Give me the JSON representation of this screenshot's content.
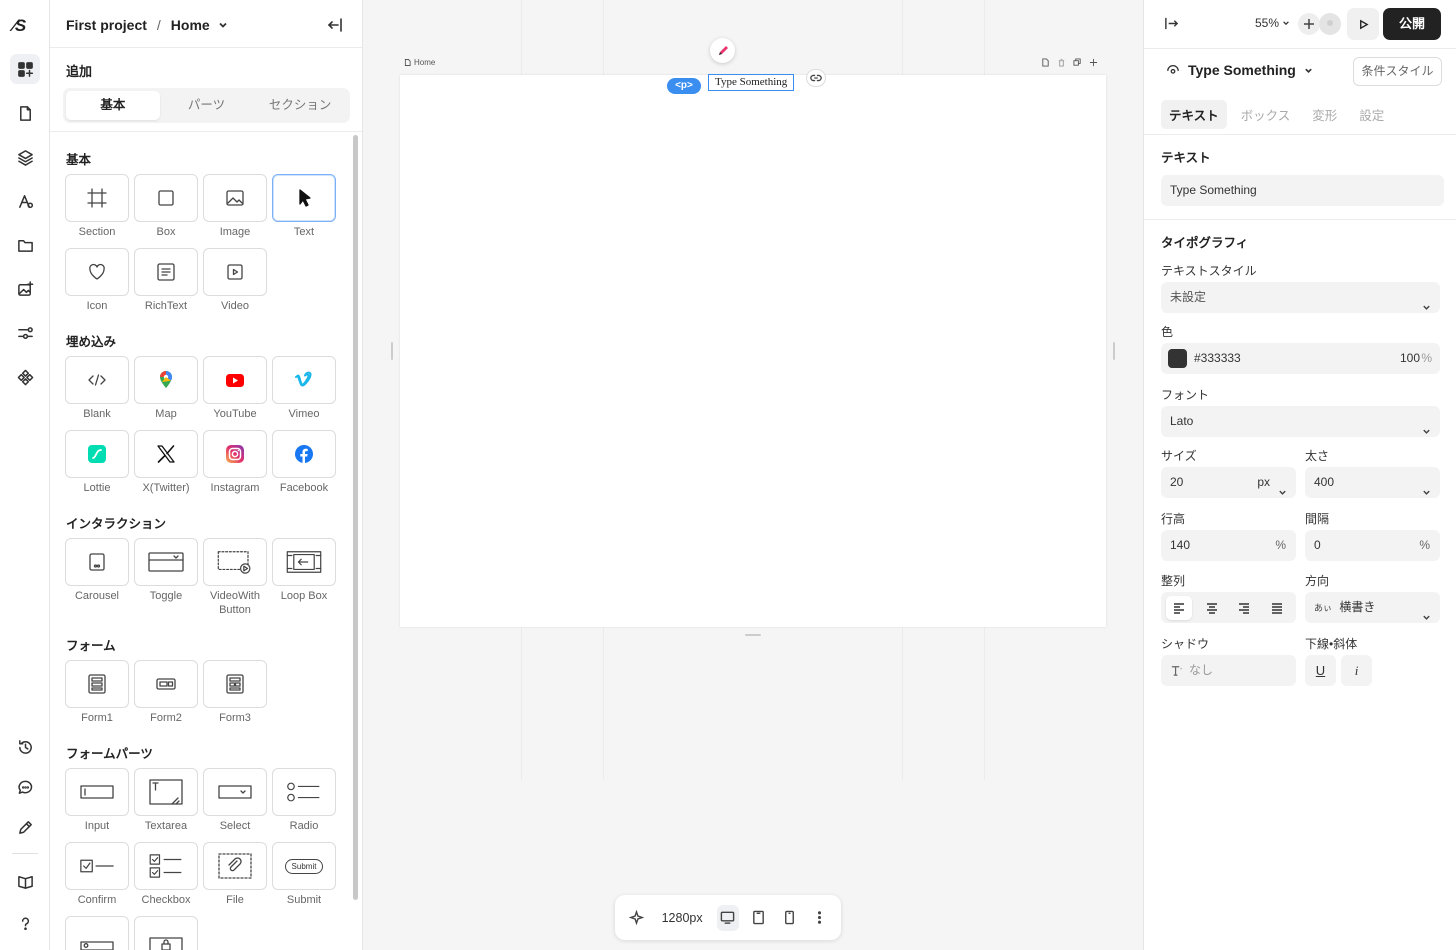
{
  "rail": {
    "logo": "⁄S",
    "icons": [
      "add-elements-icon",
      "pages-icon",
      "layers-icon",
      "styles-icon",
      "folder-icon",
      "media-icon",
      "components-icon",
      "widgets-icon",
      "history-icon",
      "comments-icon",
      "edit-icon",
      "docs-icon",
      "help-icon"
    ]
  },
  "left_panel": {
    "project": "First project",
    "separator": "/",
    "page": "Home",
    "add_title": "追加",
    "tabs": [
      "基本",
      "パーツ",
      "セクション"
    ],
    "active_tab": 0,
    "sections": {
      "basic": {
        "title": "基本",
        "items": [
          "Section",
          "Box",
          "Image",
          "Text",
          "Icon",
          "RichText",
          "Video"
        ]
      },
      "embed": {
        "title": "埋め込み",
        "items": [
          "Blank",
          "Map",
          "YouTube",
          "Vimeo",
          "Lottie",
          "X(Twitter)",
          "Instagram",
          "Facebook"
        ]
      },
      "interaction": {
        "title": "インタラクション",
        "items": [
          "Carousel",
          "Toggle",
          "VideoWith Button",
          "Loop Box"
        ]
      },
      "form": {
        "title": "フォーム",
        "items": [
          "Form1",
          "Form2",
          "Form3"
        ]
      },
      "form_parts": {
        "title": "フォームパーツ",
        "items": [
          "Input",
          "Textarea",
          "Select",
          "Radio",
          "Confirm",
          "Checkbox",
          "File",
          "Submit"
        ]
      }
    },
    "submit_tile_text": "Submit",
    "selected_item": "Text"
  },
  "canvas": {
    "artboard_label": "Home",
    "tag": "<p>",
    "selected_text": "Type Something",
    "width_label": "1280px"
  },
  "right_panel": {
    "zoom": "55%",
    "publish_label": "公開",
    "element_name": "Type Something",
    "conditional_style": "条件スタイル",
    "tabs": [
      "テキスト",
      "ボックス",
      "変形",
      "設定"
    ],
    "active_tab": 0,
    "text_section_title": "テキスト",
    "text_value": "Type Something",
    "typography_title": "タイポグラフィ",
    "text_style_label": "テキストスタイル",
    "text_style_value": "未設定",
    "color_label": "色",
    "color_hex": "#333333",
    "color_opacity": "100",
    "percent": "%",
    "font_label": "フォント",
    "font_value": "Lato",
    "size_label": "サイズ",
    "size_value": "20",
    "size_unit": "px",
    "weight_label": "太さ",
    "weight_value": "400",
    "line_height_label": "行高",
    "line_height_value": "140",
    "spacing_label": "間隔",
    "spacing_value": "0",
    "align_label": "整列",
    "direction_label": "方向",
    "direction_value": "横書き",
    "direction_icon_text": "あぃ",
    "shadow_label": "シャドウ",
    "shadow_value": "なし",
    "decoration_label": "下線•斜体",
    "underline_glyph": "U",
    "italic_glyph": "i"
  },
  "colors": {
    "accent": "#3a8ef0",
    "publish_bg": "#222222",
    "text_color": "#333333"
  }
}
